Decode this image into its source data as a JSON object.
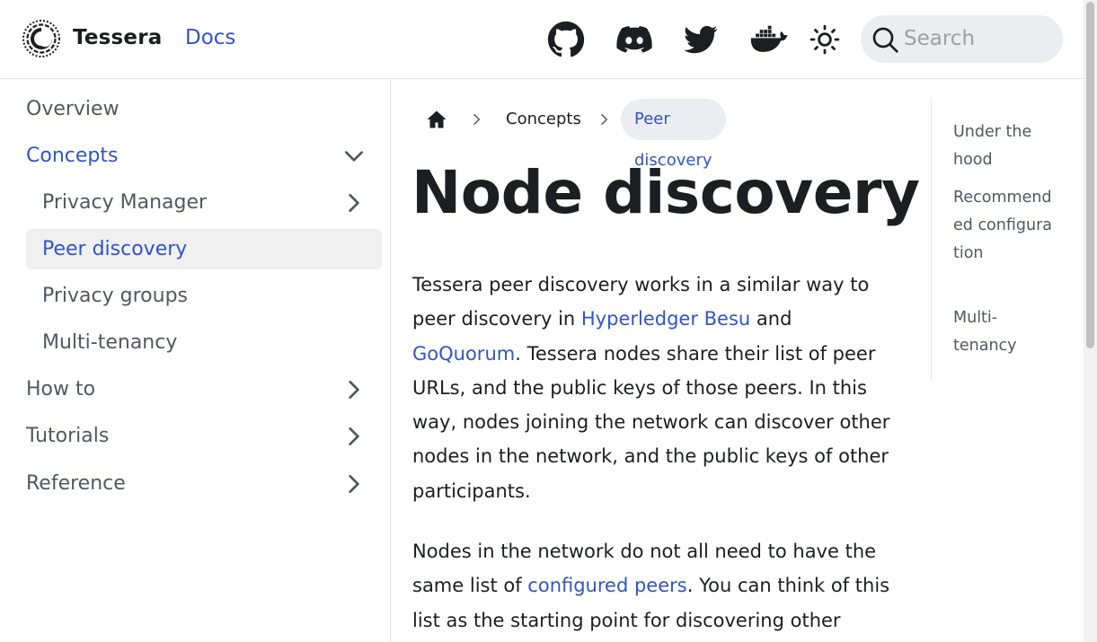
{
  "navbar": {
    "brand": "Tessera",
    "docs_link": "Docs",
    "icons": [
      "github-icon",
      "discord-icon",
      "twitter-icon",
      "docker-icon",
      "sun-icon"
    ],
    "search_placeholder": "Search"
  },
  "sidebar": {
    "items": [
      {
        "label": "Overview"
      },
      {
        "label": "Concepts"
      },
      {
        "label": "Privacy Manager"
      },
      {
        "label": "Peer discovery"
      },
      {
        "label": "Privacy groups"
      },
      {
        "label": "Multi-tenancy"
      },
      {
        "label": "How to"
      },
      {
        "label": "Tutorials"
      },
      {
        "label": "Reference"
      }
    ]
  },
  "breadcrumbs": {
    "items": [
      "Concepts",
      "Peer discovery"
    ]
  },
  "main": {
    "title": "Node discovery",
    "para1": {
      "t1": "Tessera peer discovery works in a similar way to peer discovery in ",
      "link1": "Hyperledger Besu",
      "t2": " and ",
      "link2": "GoQuorum",
      "t3": ". Tessera nodes share their list of peer URLs, and the public keys of those peers. In this way, nodes joining the network can discover other nodes in the network, and the public keys of other participants."
    },
    "para2": {
      "t1": "Nodes in the network do not all need to have the same list of ",
      "link1": "configured peers",
      "t2": ". You can think of this list as the starting point for discovering other"
    }
  },
  "toc": {
    "items": [
      "Under the hood",
      "Recommended configuration",
      "Multi-tenancy"
    ]
  },
  "colors": {
    "accent": "#3254c6",
    "text": "#1c1e21",
    "muted": "#525860",
    "selected_bg": "#f0f0f0"
  }
}
